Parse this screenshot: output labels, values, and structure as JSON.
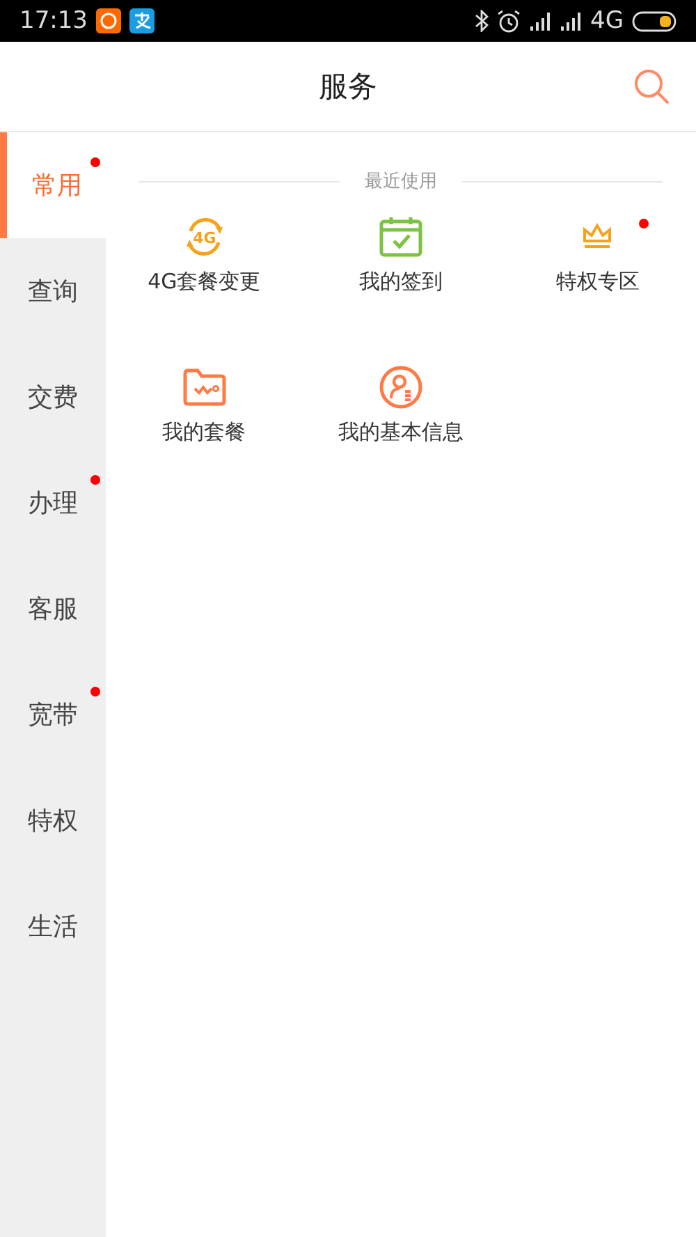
{
  "status_bar": {
    "time": "17:13",
    "network": "4G"
  },
  "header": {
    "title": "服务"
  },
  "sidebar": {
    "items": [
      {
        "label": "常用",
        "selected": true,
        "badge": true
      },
      {
        "label": "查询",
        "selected": false,
        "badge": false
      },
      {
        "label": "交费",
        "selected": false,
        "badge": false
      },
      {
        "label": "办理",
        "selected": false,
        "badge": true
      },
      {
        "label": "客服",
        "selected": false,
        "badge": false
      },
      {
        "label": "宽带",
        "selected": false,
        "badge": true
      },
      {
        "label": "特权",
        "selected": false,
        "badge": false
      },
      {
        "label": "生活",
        "selected": false,
        "badge": false
      }
    ]
  },
  "section": {
    "title": "最近使用",
    "items": [
      {
        "kind": "network",
        "icon_text": "4G",
        "label": "4G套餐变更",
        "badge": false
      },
      {
        "kind": "checkin",
        "label": "我的签到",
        "badge": false
      },
      {
        "kind": "crown",
        "label": "特权专区",
        "badge": true
      },
      {
        "kind": "plan",
        "label": "我的套餐",
        "badge": false
      },
      {
        "kind": "profile",
        "label": "我的基本信息",
        "badge": false
      }
    ]
  }
}
